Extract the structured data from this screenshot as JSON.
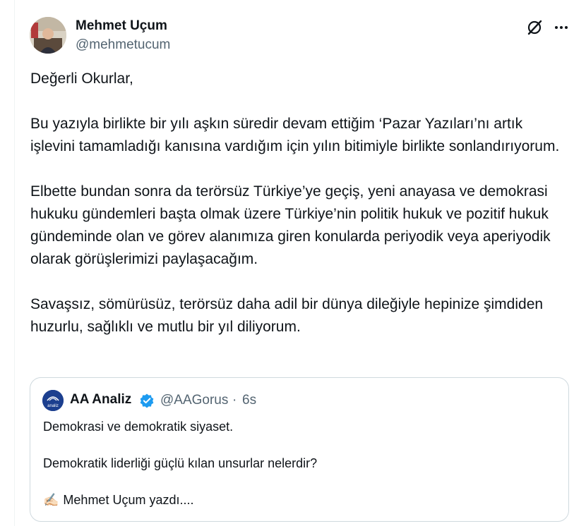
{
  "author": {
    "name": "Mehmet Uçum",
    "handle": "@mehmetucum"
  },
  "tweet": {
    "paragraphs": [
      "Değerli Okurlar,",
      "Bu yazıyla birlikte bir yılı aşkın süredir devam ettiğim ‘Pazar Yazıları’nı artık işlevini tamamladığı kanısına vardığım için yılın bitimiyle birlikte sonlandırıyorum.",
      "Elbette bundan sonra da terörsüz Türkiye’ye geçiş, yeni anayasa ve demokrasi hukuku gündemleri başta olmak üzere Türkiye’nin politik hukuk ve pozitif hukuk gündeminde olan ve görev alanımıza giren konularda periyodik veya aperiyodik olarak görüşlerimizi paylaşacağım.",
      "Savaşsız, sömürüsüz, terörsüz daha adil bir dünya dileğiyle hepinize şimdiden huzurlu, sağlıklı ve mutlu bir yıl diliyorum."
    ]
  },
  "quote": {
    "name": "AA Analiz",
    "handle": "@AAGorus",
    "separator": "·",
    "time": "6s",
    "avatar_text": "analiz",
    "lines": [
      "Demokrasi ve demokratik siyaset.",
      "Demokratik liderliği güçlü kılan unsurlar nelerdir?",
      "Mehmet Uçum yazdı...."
    ],
    "line_prefix_emoji": "✍🏻"
  },
  "icons": {
    "grok": "grok-icon",
    "more": "more-options-icon",
    "verified": "verified-badge-icon",
    "writing_hand": "writing-hand-icon"
  },
  "colors": {
    "text": "#0f1419",
    "secondary": "#536471",
    "border": "#cfd9de",
    "verified": "#1d9bf0"
  }
}
